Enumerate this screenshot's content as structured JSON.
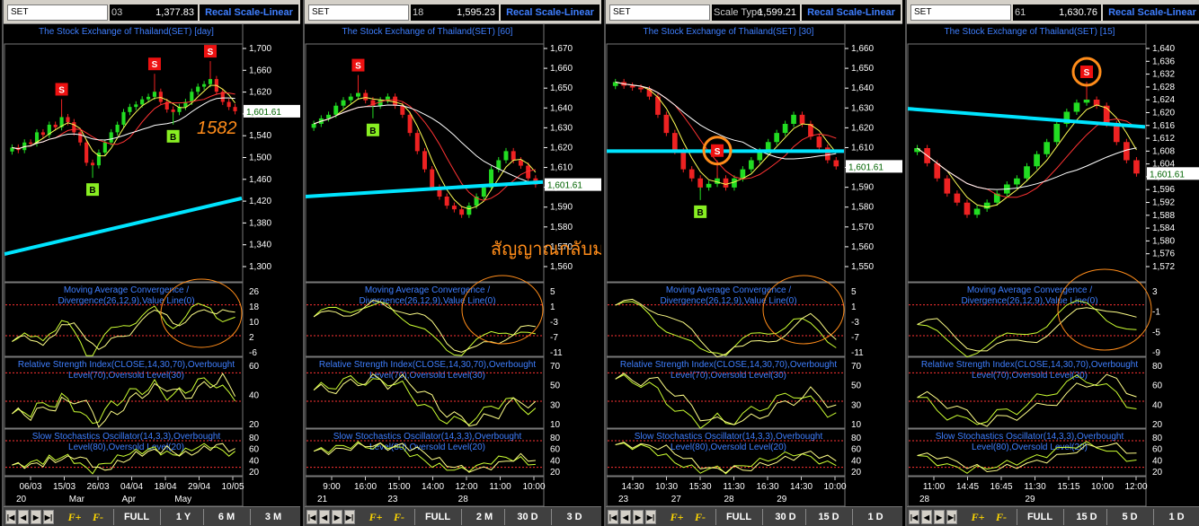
{
  "charts": [
    {
      "symbol": "SET",
      "dropdown_icon": "chevron-down-icon",
      "price_lead": "03",
      "price": "1,377.83",
      "recal_label": "Recal Scale-Linear",
      "title": "The Stock Exchange of Thailand(SET) [day]",
      "price_ticks": [
        "1,700",
        "1,660",
        "1,620",
        "1,580",
        "1,540",
        "1,500",
        "1,460",
        "1,420",
        "1,380",
        "1,340",
        "1,300"
      ],
      "current_price_label": "1,601.61",
      "macd_title": [
        "Moving Average Convergence /",
        "Divergence(26,12,9),Value Line(0)"
      ],
      "macd_ticks": [
        "26",
        "18",
        "10",
        "2",
        "-6"
      ],
      "rsi_title": [
        "Relative Strength Index(CLOSE,14,30,70),Overbought",
        "Level(70),Oversold Level(30)"
      ],
      "rsi_ticks": [
        "60",
        "40",
        "20"
      ],
      "sto_title": [
        "Slow Stochastics Oscillator(14,3,3),Overbought",
        "Level(80),Oversold Level(20)"
      ],
      "sto_ticks": [
        "80",
        "60",
        "40",
        "20"
      ],
      "time_row1": [
        "06/03",
        "15/03",
        "26/03",
        "04/04",
        "18/04",
        "29/04",
        "10/05"
      ],
      "time_row2": [
        "20",
        "Mar",
        "Apr",
        "May"
      ],
      "signals": [
        {
          "label": "S"
        },
        {
          "label": "S"
        },
        {
          "label": "S"
        },
        {
          "label": "B"
        },
        {
          "label": "B"
        }
      ],
      "annotation": "1582",
      "ma_band": "cyan",
      "nav": {
        "prev": "◀",
        "next": "▶",
        "first": "|◀",
        "last": "▶|",
        "f1": "F+",
        "f2": "F-",
        "full": "FULL",
        "z1": "1 Y",
        "z2": "6 M",
        "z3": "3 M"
      }
    },
    {
      "symbol": "SET",
      "dropdown_icon": "chevron-down-icon",
      "price_lead": "18",
      "price": "1,595.23",
      "recal_label": "Recal Scale-Linear",
      "title": "The Stock Exchange of Thailand(SET) [60]",
      "price_ticks": [
        "1,670",
        "1,660",
        "1,650",
        "1,640",
        "1,630",
        "1,620",
        "1,610",
        "1,600",
        "1,590",
        "1,580",
        "1,570",
        "1,560"
      ],
      "current_price_label": "1,601.61",
      "macd_title": [
        "Moving Average Convergence /",
        "Divergence(26,12,9),Value Line(0)"
      ],
      "macd_ticks": [
        "5",
        "1",
        "-3",
        "-7",
        "-11"
      ],
      "rsi_title": [
        "Relative Strength Index(CLOSE,14,30,70),Overbought",
        "Level(70),Oversold Level(30)"
      ],
      "rsi_ticks": [
        "70",
        "50",
        "30",
        "10"
      ],
      "sto_title": [
        "Slow Stochastics Oscillator(14,3,3),Overbought",
        "Level(80),Oversold Level(20)"
      ],
      "sto_ticks": [
        "80",
        "60",
        "40",
        "20"
      ],
      "time_row1": [
        "9:00",
        "16:00",
        "15:00",
        "14:00",
        "12:00",
        "11:00",
        "10:00"
      ],
      "time_row2": [
        "21",
        "23",
        "28"
      ],
      "signals": [
        {
          "label": "S"
        },
        {
          "label": "B"
        }
      ],
      "annotation": "สัญญาณกลับมาแย่อีกแล้ว",
      "ma_band": "cyan",
      "nav": {
        "prev": "◀",
        "next": "▶",
        "first": "|◀",
        "last": "▶|",
        "f1": "F+",
        "f2": "F-",
        "full": "FULL",
        "z1": "2 M",
        "z2": "30 D",
        "z3": "3 D"
      }
    },
    {
      "symbol": "SET",
      "dropdown_icon": "chevron-down-icon",
      "price_lead": "Scale Type",
      "price": "1,599.21",
      "recal_label": "Recal Scale-Linear",
      "title": "The Stock Exchange of Thailand(SET) [30]",
      "price_ticks": [
        "1,660",
        "1,650",
        "1,640",
        "1,630",
        "1,620",
        "1,610",
        "1,600",
        "1,590",
        "1,580",
        "1,570",
        "1,560",
        "1,550"
      ],
      "current_price_label": "1,601.61",
      "macd_title": [
        "Moving Average Convergence /",
        "Divergence(26,12,9),Value Line(0)"
      ],
      "macd_ticks": [
        "5",
        "1",
        "-3",
        "-7",
        "-11"
      ],
      "rsi_title": [
        "Relative Strength Index(CLOSE,14,30,70),Overbought",
        "Level(70),Oversold Level(30)"
      ],
      "rsi_ticks": [
        "70",
        "50",
        "30",
        "10"
      ],
      "sto_title": [
        "Slow Stochastics Oscillator(14,3,3),Overbought",
        "Level(80),Oversold Level(20)"
      ],
      "sto_ticks": [
        "80",
        "60",
        "40",
        "20"
      ],
      "time_row1": [
        "14:30",
        "10:30",
        "15:30",
        "11:30",
        "16:30",
        "14:30",
        "10:00"
      ],
      "time_row2": [
        "23",
        "27",
        "28",
        "29"
      ],
      "signals": [
        {
          "label": "S"
        },
        {
          "label": "B"
        }
      ],
      "annotation": "",
      "ma_band": "cyan",
      "nav": {
        "prev": "◀",
        "next": "▶",
        "first": "|◀",
        "last": "▶|",
        "f1": "F+",
        "f2": "F-",
        "full": "FULL",
        "z1": "30 D",
        "z2": "15 D",
        "z3": "1 D"
      }
    },
    {
      "symbol": "SET",
      "dropdown_icon": "chevron-down-icon",
      "price_lead": "61",
      "price": "1,630.76",
      "recal_label": "Recal Scale-Linear",
      "title": "The Stock Exchange of Thailand(SET) [15]",
      "price_ticks": [
        "1,640",
        "1,636",
        "1,632",
        "1,628",
        "1,624",
        "1,620",
        "1,616",
        "1,612",
        "1,608",
        "1,604",
        "1,600",
        "1,596",
        "1,592",
        "1,588",
        "1,584",
        "1,580",
        "1,576",
        "1,572"
      ],
      "current_price_label": "1,601.61",
      "macd_title": [
        "Moving Average Convergence /",
        "Divergence(26,12,9),Value Line(0)"
      ],
      "macd_ticks": [
        "3",
        "-1",
        "-5",
        "-9"
      ],
      "rsi_title": [
        "Relative Strength Index(CLOSE,14,30,70),Overbought",
        "Level(70),Oversold Level(30)"
      ],
      "rsi_ticks": [
        "80",
        "60",
        "40",
        "20"
      ],
      "sto_title": [
        "Slow Stochastics Oscillator(14,3,3),Overbought",
        "Level(80),Oversold Level(20)"
      ],
      "sto_ticks": [
        "80",
        "60",
        "40",
        "20"
      ],
      "time_row1": [
        "11:00",
        "14:45",
        "16:45",
        "11:30",
        "15:15",
        "10:00",
        "12:00"
      ],
      "time_row2": [
        "28",
        "29"
      ],
      "signals": [
        {
          "label": "S"
        }
      ],
      "annotation": "",
      "ma_band": "cyan",
      "nav": {
        "prev": "◀",
        "next": "▶",
        "first": "|◀",
        "last": "▶|",
        "f1": "F+",
        "f2": "F-",
        "full": "FULL",
        "z1": "15 D",
        "z2": "5 D",
        "z3": "1 D"
      }
    }
  ],
  "colors": {
    "up": "#22dd22",
    "down": "#ee2222",
    "ma_fast": "#ffff55",
    "ma_mid": "#ff3333",
    "ma_slow": "#ffffff",
    "ma_long": "#00e5ff",
    "title": "#3f7fff",
    "ticks": "#ffffff",
    "annotation": "#ff8c1a",
    "current_label_bg": "#ffffff",
    "current_label_fg": "#006400"
  },
  "chart_data": [
    {
      "type": "candlestick",
      "title": "The Stock Exchange of Thailand(SET) [day]",
      "ylim": [
        1290,
        1720
      ],
      "close": [
        1530,
        1525,
        1540,
        1538,
        1560,
        1555,
        1575,
        1570,
        1590,
        1580,
        1560,
        1540,
        1500,
        1495,
        1520,
        1540,
        1560,
        1575,
        1600,
        1610,
        1615,
        1625,
        1630,
        1640,
        1620,
        1605,
        1600,
        1610,
        1620,
        1640,
        1650,
        1655,
        1665,
        1640,
        1620,
        1610,
        1601.61
      ],
      "series": [
        {
          "name": "MA long",
          "start": 1320,
          "end": 1430
        }
      ]
    },
    {
      "type": "candlestick",
      "title": "The Stock Exchange of Thailand(SET) [60]",
      "ylim": [
        1555,
        1675
      ],
      "close": [
        1635,
        1638,
        1640,
        1645,
        1648,
        1650,
        1652,
        1648,
        1645,
        1648,
        1650,
        1645,
        1640,
        1630,
        1620,
        1610,
        1600,
        1595,
        1590,
        1588,
        1585,
        1590,
        1595,
        1600,
        1610,
        1615,
        1620,
        1615,
        1612,
        1605,
        1601.61
      ],
      "series": [
        {
          "name": "MA long",
          "start": 1595,
          "end": 1603
        }
      ]
    },
    {
      "type": "candlestick",
      "title": "The Stock Exchange of Thailand(SET) [30]",
      "ylim": [
        1545,
        1665
      ],
      "close": [
        1648,
        1646,
        1645,
        1644,
        1640,
        1630,
        1620,
        1610,
        1600,
        1595,
        1590,
        1592,
        1595,
        1590,
        1595,
        1600,
        1605,
        1610,
        1615,
        1620,
        1625,
        1630,
        1625,
        1618,
        1612,
        1605,
        1601.61
      ],
      "series": [
        {
          "name": "MA long",
          "start": 1610,
          "end": 1610
        }
      ]
    },
    {
      "type": "candlestick",
      "title": "The Stock Exchange of Thailand(SET) [15]",
      "ylim": [
        1570,
        1642
      ],
      "close": [
        1610,
        1605,
        1600,
        1595,
        1592,
        1588,
        1590,
        1592,
        1595,
        1598,
        1600,
        1604,
        1608,
        1612,
        1618,
        1622,
        1625,
        1626,
        1624,
        1618,
        1612,
        1606,
        1601.61
      ],
      "series": [
        {
          "name": "MA long",
          "start": 1623,
          "end": 1617
        }
      ]
    }
  ]
}
